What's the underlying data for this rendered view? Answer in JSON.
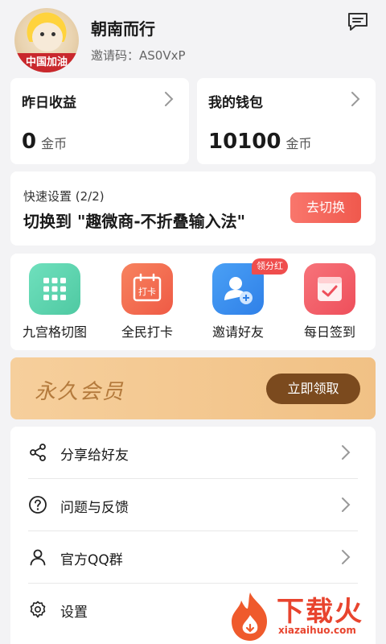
{
  "header": {
    "avatar_ribbon": "中国加油",
    "username": "朝南而行",
    "invite_label": "邀请码：",
    "invite_code": "AS0VxP",
    "message_icon": "message-square-icon"
  },
  "stats": [
    {
      "title": "昨日收益",
      "value": "0",
      "unit": "金币"
    },
    {
      "title": "我的钱包",
      "value": "10100",
      "unit": "金币"
    }
  ],
  "quick_setting": {
    "title": "快速设置 (2/2)",
    "main": "切换到 \"趣微商-不折叠输入法\"",
    "button": "去切换"
  },
  "features": [
    {
      "label": "九宫格切图",
      "icon": "grid-nine-icon",
      "color": "#5fd6b0"
    },
    {
      "label": "全民打卡",
      "icon": "calendar-checkin-icon",
      "color": "#f26a50",
      "icon_text": "打卡"
    },
    {
      "label": "邀请好友",
      "icon": "invite-friend-icon",
      "color": "#3d8ef0",
      "badge": "领分红"
    },
    {
      "label": "每日签到",
      "icon": "daily-signin-icon",
      "color": "#f4616a"
    }
  ],
  "vip": {
    "title": "永久会员",
    "button": "立即领取"
  },
  "menu": [
    {
      "label": "分享给好友",
      "icon": "share-icon"
    },
    {
      "label": "问题与反馈",
      "icon": "question-icon"
    },
    {
      "label": "官方QQ群",
      "icon": "user-icon"
    },
    {
      "label": "设置",
      "icon": "gear-icon"
    }
  ],
  "watermark": {
    "text": "下载火",
    "url": "xiazaihuo.com"
  }
}
